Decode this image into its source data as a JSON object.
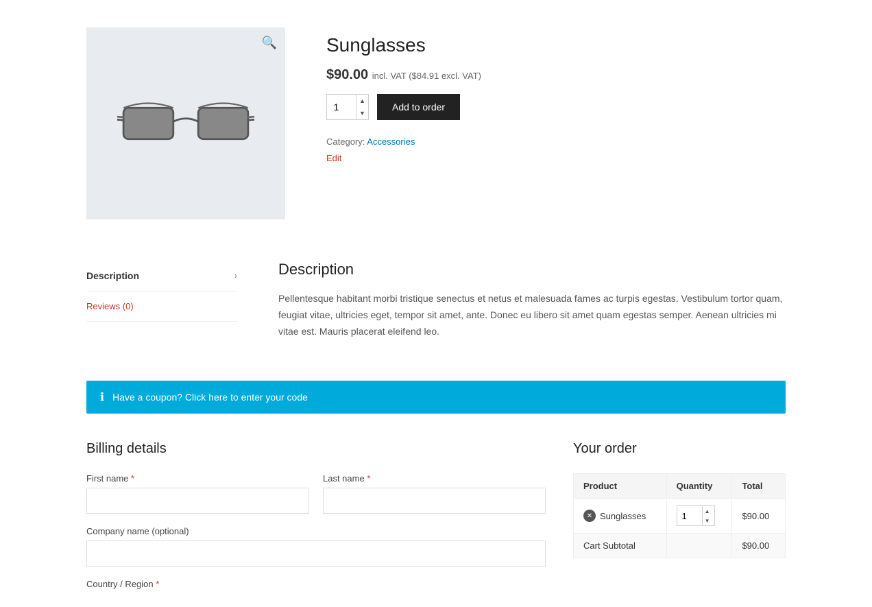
{
  "product": {
    "title": "Sunglasses",
    "price": "$90.00",
    "price_incl": "incl. VAT",
    "price_excl": "($84.91 excl. VAT)",
    "quantity": "1",
    "add_to_order_label": "Add to order",
    "category_label": "Category:",
    "category": "Accessories",
    "edit_label": "Edit"
  },
  "tabs": [
    {
      "label": "Description",
      "active": true,
      "chevron": "›"
    },
    {
      "label": "Reviews (0)",
      "active": false,
      "chevron": ""
    }
  ],
  "description": {
    "title": "Description",
    "text": "Pellentesque habitant morbi tristique senectus et netus et malesuada fames ac turpis egestas. Vestibulum tortor quam, feugiat vitae, ultricies eget, tempor sit amet, ante. Donec eu libero sit amet quam egestas semper. Aenean ultricies mi vitae est. Mauris placerat eleifend leo."
  },
  "coupon": {
    "text": "Have a coupon? Click here to enter your code"
  },
  "billing": {
    "title": "Billing details",
    "first_name_label": "First name",
    "first_name_required": "*",
    "last_name_label": "Last name",
    "last_name_required": "*",
    "company_name_label": "Company name (optional)",
    "country_label": "Country / Region",
    "country_required": "*"
  },
  "your_order": {
    "title": "Your order",
    "col_product": "Product",
    "col_quantity": "Quantity",
    "col_total": "Total",
    "item_name": "Sunglasses",
    "item_qty": "1",
    "item_total": "$90.00",
    "subtotal_label": "Cart Subtotal",
    "subtotal_value": "$90.00"
  }
}
